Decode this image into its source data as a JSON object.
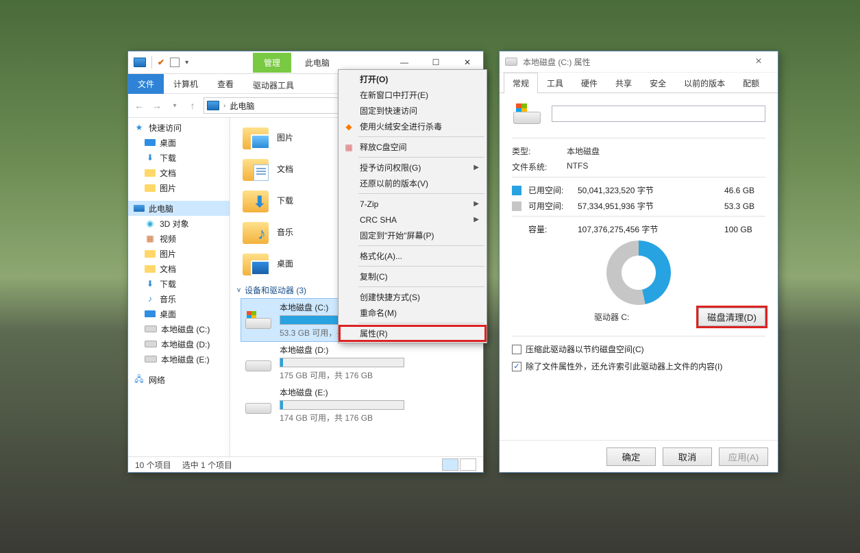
{
  "explorer": {
    "manage_tab": "管理",
    "title": "此电脑",
    "ribbon": {
      "file": "文件",
      "computer": "计算机",
      "view": "查看",
      "drive_tools": "驱动器工具"
    },
    "address": {
      "location": "此电脑"
    },
    "tree": {
      "quick_access": "快速访问",
      "desktop": "桌面",
      "downloads": "下载",
      "documents": "文档",
      "pictures": "图片",
      "this_pc": "此电脑",
      "objects3d": "3D 对象",
      "videos": "视频",
      "pictures2": "图片",
      "documents2": "文档",
      "downloads2": "下载",
      "music": "音乐",
      "desktop2": "桌面",
      "disk_c": "本地磁盘 (C:)",
      "disk_d": "本地磁盘 (D:)",
      "disk_e": "本地磁盘 (E:)",
      "network": "网络"
    },
    "folders": {
      "pictures": "图片",
      "documents": "文档",
      "downloads": "下载",
      "music": "音乐",
      "desktop": "桌面"
    },
    "group_header": "设备和驱动器 (3)",
    "drives": {
      "c": {
        "name": "本地磁盘 (C:)",
        "caption": "53.3 GB 可用，共 100 GB",
        "fill_pct": 47
      },
      "d": {
        "name": "本地磁盘 (D:)",
        "caption": "175 GB 可用，共 176 GB",
        "fill_pct": 2
      },
      "e": {
        "name": "本地磁盘 (E:)",
        "caption": "174 GB 可用，共 176 GB",
        "fill_pct": 2
      }
    },
    "status": {
      "items": "10 个项目",
      "selected": "选中 1 个项目"
    }
  },
  "ctx": {
    "open": "打开(O)",
    "open_new": "在新窗口中打开(E)",
    "pin_quick": "固定到快速访问",
    "huorong": "使用火绒安全进行杀毒",
    "free_c": "释放C盘空间",
    "grant": "授予访问权限(G)",
    "restore": "还原以前的版本(V)",
    "sevenzip": "7-Zip",
    "crcsha": "CRC SHA",
    "pin_start": "固定到\"开始\"屏幕(P)",
    "format": "格式化(A)...",
    "copy": "复制(C)",
    "shortcut": "创建快捷方式(S)",
    "rename": "重命名(M)",
    "properties": "属性(R)"
  },
  "props": {
    "title": "本地磁盘 (C:) 属性",
    "tabs": {
      "general": "常规",
      "tools": "工具",
      "hardware": "硬件",
      "sharing": "共享",
      "security": "安全",
      "prev": "以前的版本",
      "quota": "配额"
    },
    "type_label": "类型:",
    "type_value": "本地磁盘",
    "fs_label": "文件系统:",
    "fs_value": "NTFS",
    "used_label": "已用空间:",
    "used_bytes": "50,041,323,520 字节",
    "used_gb": "46.6 GB",
    "free_label": "可用空间:",
    "free_bytes": "57,334,951,936 字节",
    "free_gb": "53.3 GB",
    "cap_label": "容量:",
    "cap_bytes": "107,376,275,456 字节",
    "cap_gb": "100 GB",
    "drive_label": "驱动器 C:",
    "disk_cleanup": "磁盘清理(D)",
    "compress": "压缩此驱动器以节约磁盘空间(C)",
    "index": "除了文件属性外，还允许索引此驱动器上文件的内容(I)",
    "ok": "确定",
    "cancel": "取消",
    "apply": "应用(A)"
  }
}
